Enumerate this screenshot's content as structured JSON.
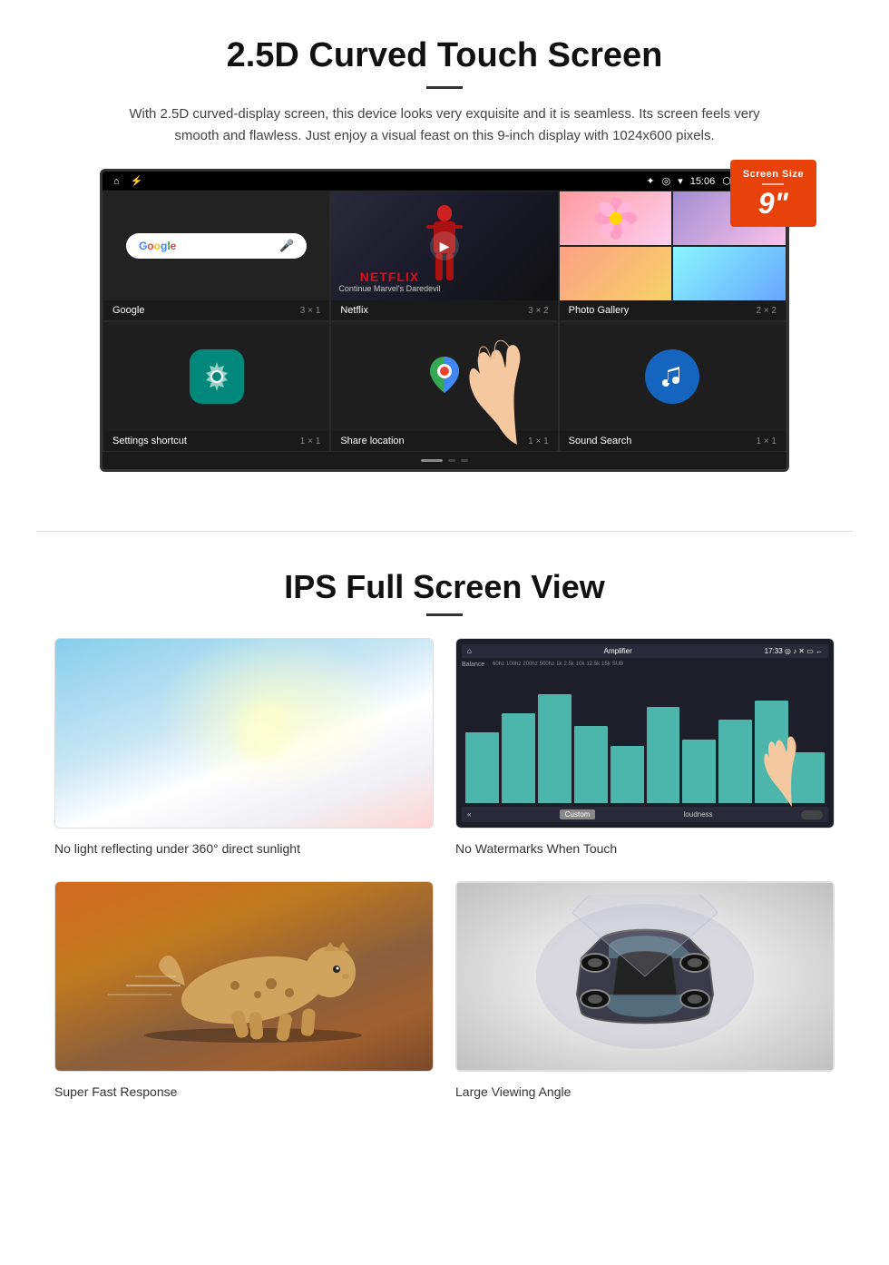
{
  "section1": {
    "title": "2.5D Curved Touch Screen",
    "description": "With 2.5D curved-display screen, this device looks very exquisite and it is seamless. Its screen feels very smooth and flawless. Just enjoy a visual feast on this 9-inch display with 1024x600 pixels.",
    "screen_size_badge": {
      "label": "Screen Size",
      "size": "9\""
    },
    "status_bar": {
      "time": "15:06"
    },
    "apps": [
      {
        "name": "Google",
        "size": "3 × 1"
      },
      {
        "name": "Netflix",
        "size": "3 × 2",
        "subtitle": "Continue Marvel's Daredevil"
      },
      {
        "name": "Photo Gallery",
        "size": "2 × 2"
      },
      {
        "name": "Settings shortcut",
        "size": "1 × 1"
      },
      {
        "name": "Share location",
        "size": "1 × 1"
      },
      {
        "name": "Sound Search",
        "size": "1 × 1"
      }
    ]
  },
  "section2": {
    "title": "IPS Full Screen View",
    "features": [
      {
        "id": "no-light",
        "caption": "No light reflecting under 360° direct sunlight"
      },
      {
        "id": "no-watermarks",
        "caption": "No Watermarks When Touch"
      },
      {
        "id": "fast-response",
        "caption": "Super Fast Response"
      },
      {
        "id": "wide-angle",
        "caption": "Large Viewing Angle"
      }
    ]
  }
}
